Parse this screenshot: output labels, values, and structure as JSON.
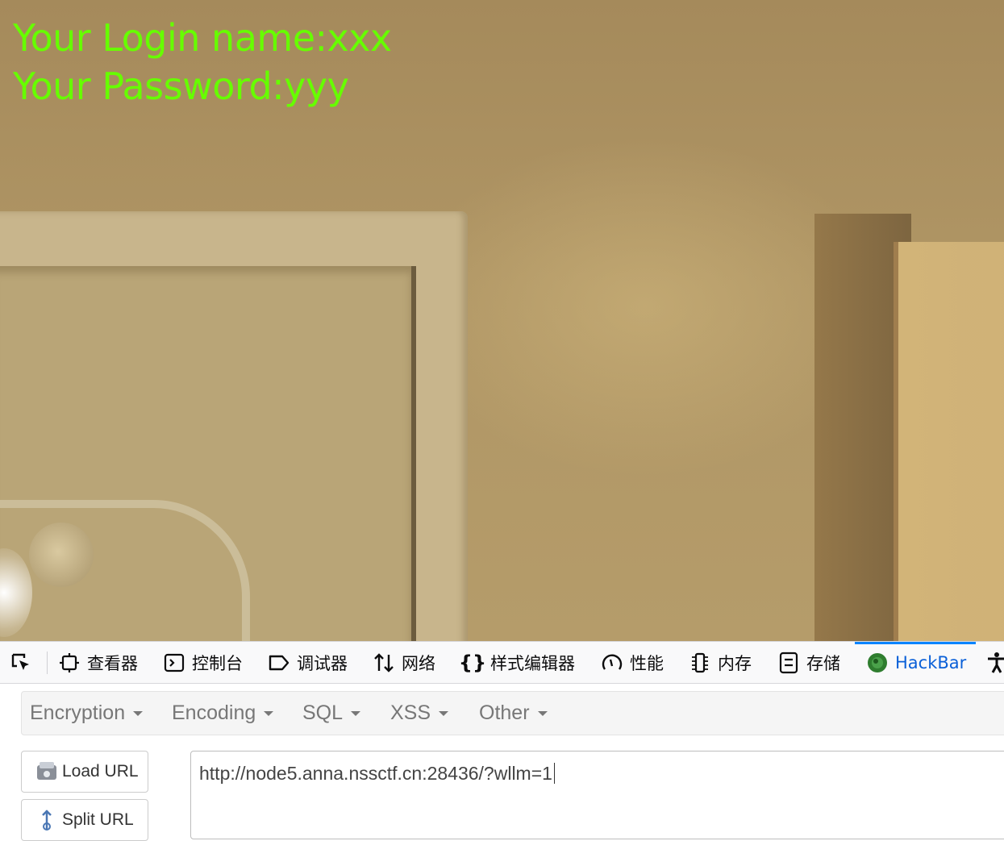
{
  "page": {
    "login_line": "Your Login name:xxx",
    "password_line": "Your Password:yyy",
    "text_color": "#66ff00"
  },
  "devtools": {
    "tabs": [
      {
        "label": "",
        "icon": "element-picker-icon"
      },
      {
        "label": "查看器",
        "icon": "inspector-icon"
      },
      {
        "label": "控制台",
        "icon": "console-icon"
      },
      {
        "label": "调试器",
        "icon": "debugger-icon"
      },
      {
        "label": "网络",
        "icon": "network-icon"
      },
      {
        "label": "样式编辑器",
        "icon": "style-editor-icon"
      },
      {
        "label": "性能",
        "icon": "performance-icon"
      },
      {
        "label": "内存",
        "icon": "memory-icon"
      },
      {
        "label": "存储",
        "icon": "storage-icon"
      },
      {
        "label": "HackBar",
        "icon": "hackbar-icon",
        "active": true
      },
      {
        "label": "",
        "icon": "accessibility-icon"
      }
    ],
    "active_color": "#0a84ff"
  },
  "hackbar": {
    "menus": [
      "Encryption",
      "Encoding",
      "SQL",
      "XSS",
      "Other"
    ],
    "load_url_label": "Load URL",
    "split_url_label": "Split URL",
    "url_value": "http://node5.anna.nssctf.cn:28436/?wllm=1"
  }
}
